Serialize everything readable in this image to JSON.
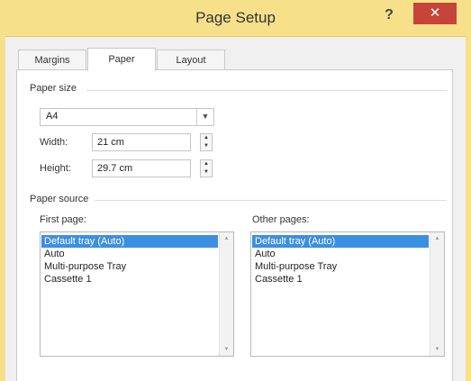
{
  "window": {
    "title": "Page Setup",
    "help_label": "?",
    "close_label": "✕"
  },
  "tabs": [
    {
      "label": "Margins"
    },
    {
      "label": "Paper"
    },
    {
      "label": "Layout"
    }
  ],
  "paper_size": {
    "group_label": "Paper size",
    "selected": "A4",
    "width_label": "Width:",
    "width_value": "21 cm",
    "height_label": "Height:",
    "height_value": "29.7 cm"
  },
  "paper_source": {
    "group_label": "Paper source",
    "first_page": {
      "label": "First page:",
      "items": [
        "Default tray (Auto)",
        "Auto",
        "Multi-purpose Tray",
        "Cassette 1"
      ],
      "selected_index": 0
    },
    "other_pages": {
      "label": "Other pages:",
      "items": [
        "Default tray (Auto)",
        "Auto",
        "Multi-purpose Tray",
        "Cassette 1"
      ],
      "selected_index": 0
    }
  },
  "icons": {
    "dropdown": "chevron-down-icon",
    "spin_up": "triangle-up-icon",
    "spin_down": "triangle-down-icon"
  },
  "colors": {
    "titlebar": "#f6e18a",
    "close_button": "#c7443a",
    "selection": "#3c8fe0"
  }
}
